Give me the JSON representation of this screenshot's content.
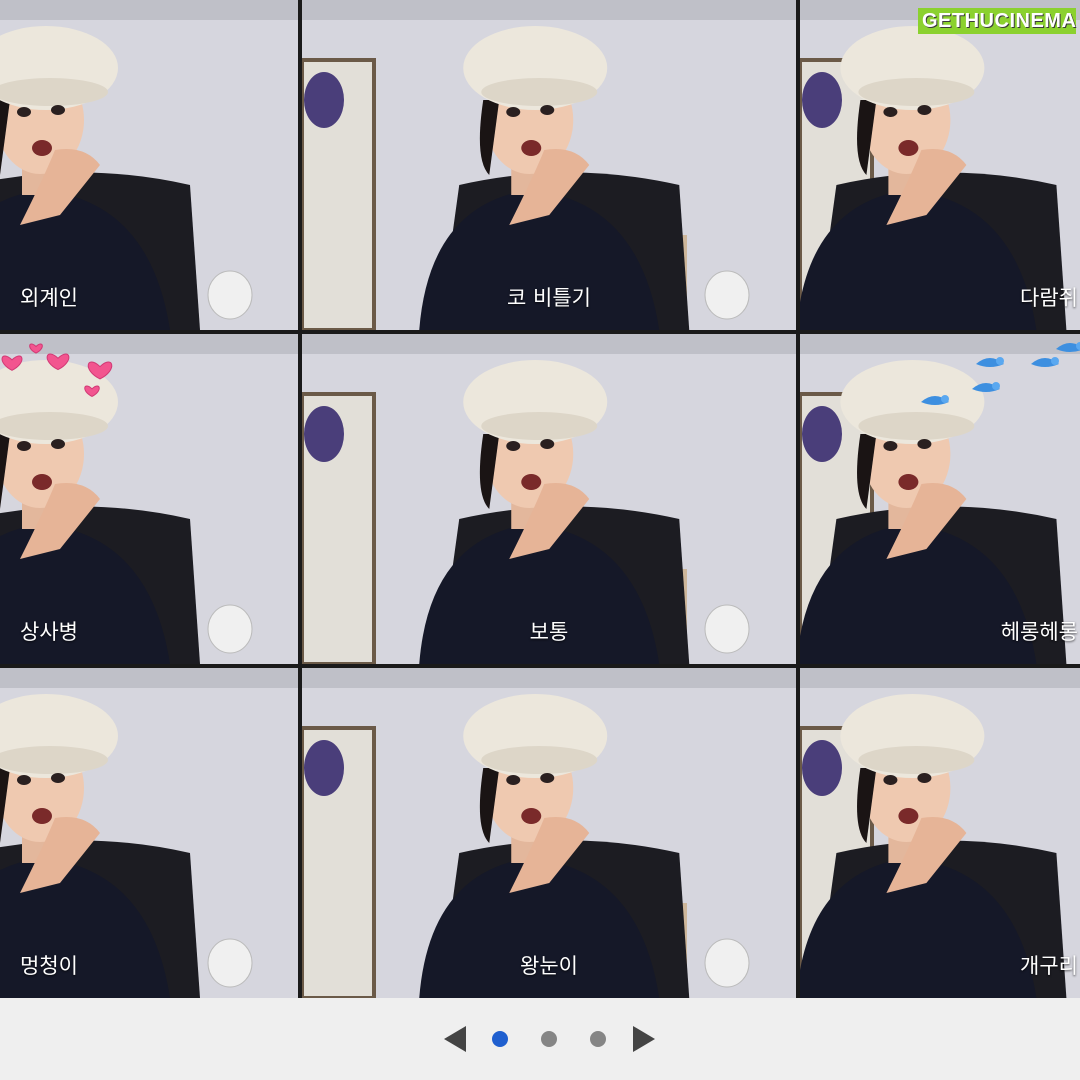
{
  "watermark": {
    "part1": "GETHU",
    "part2": "CINEMA"
  },
  "filters": [
    {
      "label": "외계인",
      "effect": "none"
    },
    {
      "label": "코 비틀기",
      "effect": "none"
    },
    {
      "label": "다람쥐",
      "effect": "none"
    },
    {
      "label": "상사병",
      "effect": "hearts"
    },
    {
      "label": "보통",
      "effect": "none"
    },
    {
      "label": "헤롱헤롱",
      "effect": "birds"
    },
    {
      "label": "멍청이",
      "effect": "none"
    },
    {
      "label": "왕눈이",
      "effect": "none"
    },
    {
      "label": "개구리",
      "effect": "none"
    }
  ],
  "pager": {
    "pages": 3,
    "current": 1,
    "icons": {
      "prev": "triangle-left-icon",
      "next": "triangle-right-icon"
    }
  },
  "colors": {
    "active_dot": "#1f5fcf",
    "inactive_dot": "#858585",
    "pager_bg": "#efefef",
    "watermark_bg": "#8bd12f"
  }
}
